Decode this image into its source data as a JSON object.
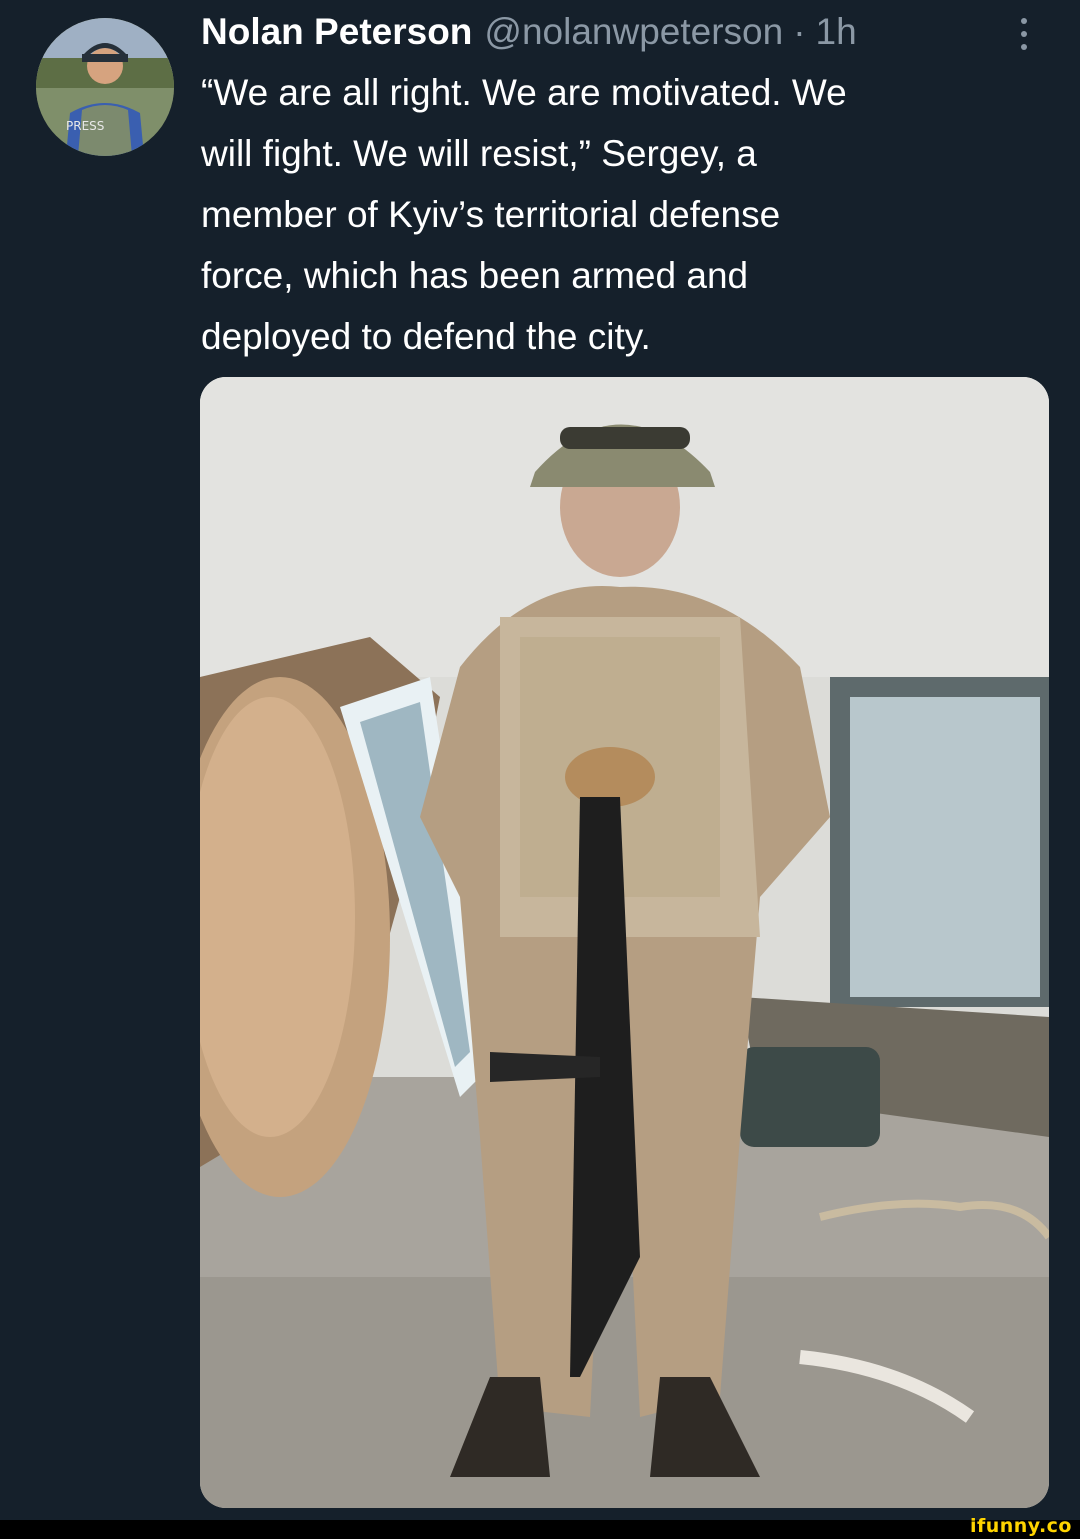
{
  "tweet": {
    "author": {
      "display_name": "Nolan Peterson",
      "handle": "@nolanwpeterson",
      "avatar_text": "PRESS"
    },
    "separator": "·",
    "time": "1h",
    "more_icon": "more-vertical-icon",
    "text": "“We are all right. We are motivated. We\nwill fight. We will resist,” Sergey, a\nmember of Kyiv’s territorial defense\nforce, which has been armed and\ndeployed to defend the city.",
    "media": {
      "image_subject": "soldier-photo"
    }
  },
  "watermark": {
    "text": "ifunny.co",
    "color": "#ffd400"
  },
  "colors": {
    "background": "#15202b",
    "secondary_text": "#8b98a5",
    "primary_text": "#ffffff"
  }
}
